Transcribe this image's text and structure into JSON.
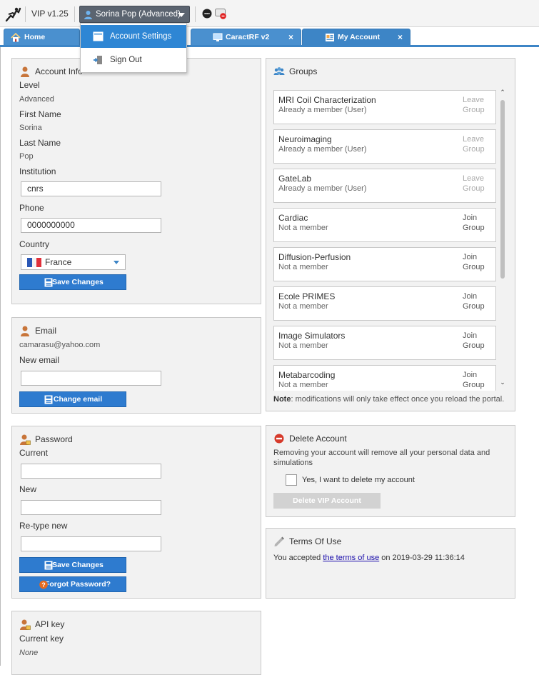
{
  "topbar": {
    "version": "VIP v1.25",
    "user_menu_label": "Sorina Pop (Advanced)"
  },
  "user_menu": {
    "items": [
      {
        "label": "Account Settings",
        "icon": "settings-icon",
        "highlighted": true
      },
      {
        "label": "Sign Out",
        "icon": "sign-out-icon",
        "highlighted": false
      }
    ]
  },
  "tabs": [
    {
      "label": "Home",
      "icon": "home-icon",
      "closable": false
    },
    {
      "label": "CaractRF v2",
      "icon": "monitor-icon",
      "closable": true
    },
    {
      "label": "My Account",
      "icon": "account-icon",
      "closable": true,
      "active": true
    }
  ],
  "account_info": {
    "title": "Account Info",
    "level_label": "Level",
    "level_value": "Advanced",
    "first_name_label": "First Name",
    "first_name_value": "Sorina",
    "last_name_label": "Last Name",
    "last_name_value": "Pop",
    "institution_label": "Institution",
    "institution_value": "cnrs",
    "phone_label": "Phone",
    "phone_value": "0000000000",
    "country_label": "Country",
    "country_value": "France",
    "save_label": "Save Changes"
  },
  "email": {
    "title": "Email",
    "current_email": "camarasu@yahoo.com",
    "new_email_label": "New email",
    "new_email_value": "",
    "change_label": "Change email"
  },
  "password": {
    "title": "Password",
    "current_label": "Current",
    "new_label": "New",
    "retype_label": "Re-type new",
    "save_label": "Save Changes",
    "forgot_label": "Forgot Password?"
  },
  "api_key": {
    "title": "API key",
    "current_label": "Current key",
    "current_value": "None"
  },
  "groups": {
    "title": "Groups",
    "items": [
      {
        "name": "MRI Coil Characterization",
        "status": "Already a member (User)",
        "action_line1": "Leave",
        "action_line2": "Group",
        "kind": "leave"
      },
      {
        "name": "Neuroimaging",
        "status": "Already a member (User)",
        "action_line1": "Leave",
        "action_line2": "Group",
        "kind": "leave"
      },
      {
        "name": "GateLab",
        "status": "Already a member (User)",
        "action_line1": "Leave",
        "action_line2": "Group",
        "kind": "leave"
      },
      {
        "name": "Cardiac",
        "status": "Not a member",
        "action_line1": "Join",
        "action_line2": "Group",
        "kind": "join"
      },
      {
        "name": "Diffusion-Perfusion",
        "status": "Not a member",
        "action_line1": "Join",
        "action_line2": "Group",
        "kind": "join"
      },
      {
        "name": "Ecole PRIMES",
        "status": "Not a member",
        "action_line1": "Join",
        "action_line2": "Group",
        "kind": "join"
      },
      {
        "name": "Image Simulators",
        "status": "Not a member",
        "action_line1": "Join",
        "action_line2": "Group",
        "kind": "join"
      },
      {
        "name": "Metabarcoding",
        "status": "Not a member",
        "action_line1": "Join",
        "action_line2": "Group",
        "kind": "join"
      }
    ],
    "note_bold": "Note",
    "note_text": ": modifications will only take effect once you reload the portal."
  },
  "delete_account": {
    "title": "Delete Account",
    "description": "Removing your account will remove all your personal data and simulations",
    "confirm_label": "Yes, I want to delete my account",
    "button_label": "Delete VIP Account"
  },
  "terms": {
    "title": "Terms Of Use",
    "text_before": "You accepted ",
    "link_text": "the terms of use",
    "text_after": " on 2019-03-29 11:36:14"
  },
  "colors": {
    "accent": "#3d85c6",
    "button": "#2e7bcf",
    "panel_bg": "#f2f2f2",
    "disabled_button": "#d2d2d2"
  }
}
